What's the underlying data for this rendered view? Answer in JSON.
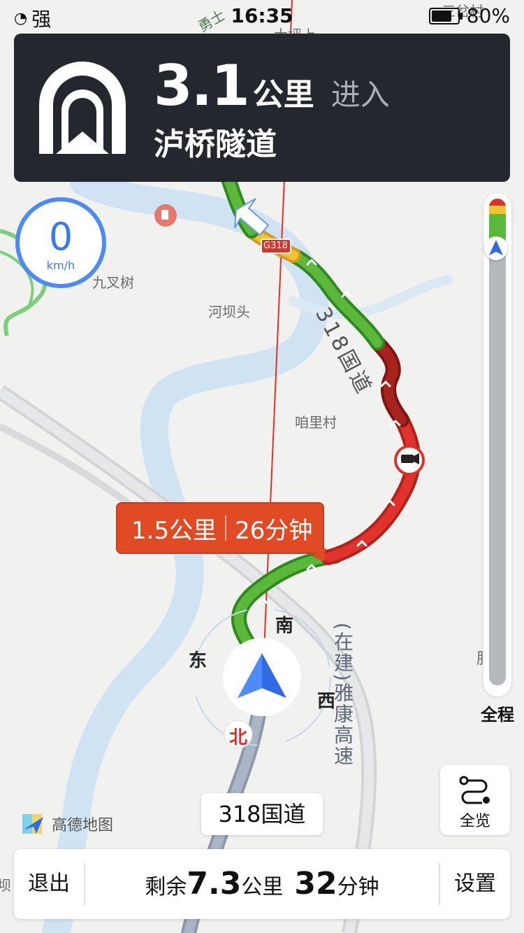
{
  "status_bar": {
    "signal_label": "强",
    "time": "16:35",
    "battery": "80%",
    "battery_level": 0.8
  },
  "guidance": {
    "distance": "3.1",
    "unit": "公里",
    "action": "进入",
    "road": "泸桥隧道",
    "icon": "tunnel-icon"
  },
  "speed": {
    "value": "0",
    "unit": "km/h"
  },
  "map_labels": {
    "top_village_1": "勇士",
    "top_village_2": "大坪上",
    "top_village_3": "三岔村",
    "village_1": "九叉树",
    "village_2": "河坝头",
    "village_3": "咱里村",
    "village_4": "肥坪",
    "highway_shield": "G318",
    "road_318": "318国道",
    "road_yakang": "(在建)雅康高速",
    "left_edge": "坝"
  },
  "compass": {
    "south": "南",
    "east": "东",
    "west": "西",
    "north": "北"
  },
  "route_bubble": {
    "distance": "1.5公里",
    "time": "26分钟"
  },
  "progress": {
    "label": "全程",
    "colors": {
      "red": "#d8342a",
      "yellow": "#f2c230",
      "green": "#5bb83a",
      "gray": "#b5b8bd"
    }
  },
  "overview": {
    "label": "全览",
    "icon": "route-overview-icon"
  },
  "current_road": "318国道",
  "logo": {
    "text": "高德地图"
  },
  "bottom_bar": {
    "exit": "退出",
    "remaining_prefix": "剩余",
    "remaining_distance": "7.3",
    "distance_unit": "公里",
    "remaining_time": "32",
    "time_unit": "分钟",
    "settings": "设置"
  }
}
